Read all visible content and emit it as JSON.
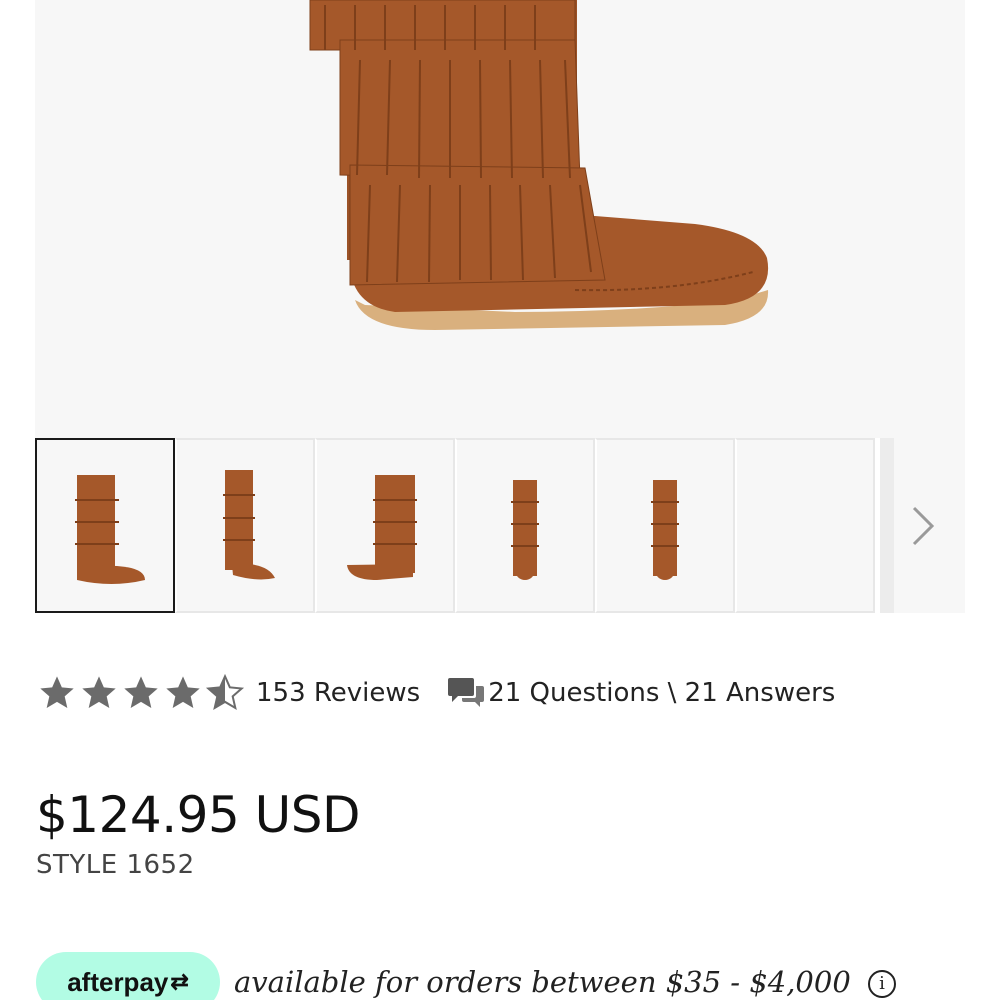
{
  "product": {
    "image_alt": "Fringe knee-high moccasin boot",
    "thumbnail_count": 6,
    "active_thumbnail": 1
  },
  "rating": {
    "value": 4.5,
    "max": 5,
    "reviews_label": "153 Reviews",
    "qa_label": "21 Questions \\ 21 Answers"
  },
  "pricing": {
    "price": "$124.95 USD",
    "style": "STYLE 1652"
  },
  "afterpay": {
    "brand": "afterpay",
    "text": "available for orders between $35 - $4,000",
    "info_glyph": "i"
  },
  "colors": {
    "suede": "#a5582a",
    "suede_dark": "#7e3f1a",
    "sole": "#d9b07e",
    "afterpay_mint": "#b2fce4",
    "star": "#6b6b6b"
  }
}
